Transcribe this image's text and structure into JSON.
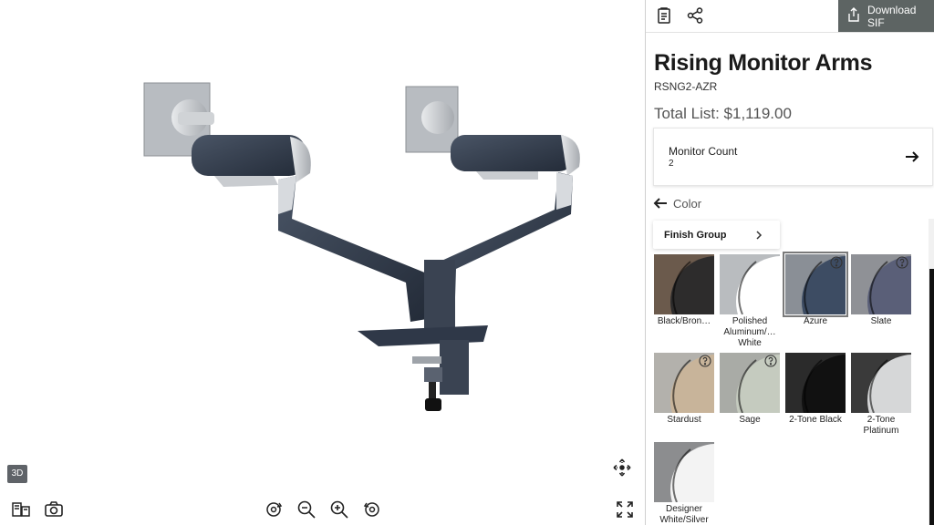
{
  "viewer": {
    "badge_3d": "3D",
    "icons": [
      "ar-view-icon",
      "camera-icon",
      "rotate-left-icon",
      "zoom-out-icon",
      "zoom-in-icon",
      "rotate-right-icon",
      "fullscreen-icon",
      "move-icon"
    ]
  },
  "panel": {
    "download_label": "Download SIF",
    "title": "Rising Monitor Arms",
    "sku": "RSNG2-AZR",
    "price": "Total List: $1,119.00",
    "monitor_card": {
      "label": "Monitor Count",
      "value": "2"
    },
    "back_label": "Color",
    "finish_group_label": "Finish Group",
    "selected_swatch": "Azure",
    "swatches": [
      {
        "name": "Black/Bron…",
        "color": "#2d2c2c",
        "tint": "#6b5a4c",
        "help": false
      },
      {
        "name": "Polished Aluminum/… White",
        "color": "#ffffff",
        "tint": "#b9bcbf",
        "help": false
      },
      {
        "name": "Azure",
        "color": "#3d4c63",
        "tint": "#8a8f96",
        "help": true
      },
      {
        "name": "Slate",
        "color": "#5a5f78",
        "tint": "#8f9196",
        "help": true
      },
      {
        "name": "Stardust",
        "color": "#c8b49a",
        "tint": "#b3b1ac",
        "help": true
      },
      {
        "name": "Sage",
        "color": "#c5cbbf",
        "tint": "#a9aba6",
        "help": true
      },
      {
        "name": "2-Tone Black",
        "color": "#111111",
        "tint": "#2b2b2b",
        "help": false
      },
      {
        "name": "2-Tone Platinum",
        "color": "#d6d7d8",
        "tint": "#3a3a3a",
        "help": false
      },
      {
        "name": "Designer White/Silver",
        "color": "#f3f3f3",
        "tint": "#8c8d8f",
        "help": false
      }
    ]
  },
  "colors": {
    "accent_dark": "#5d6463",
    "arm_navy": "#2f3848",
    "arm_silver": "#c9ccd0"
  }
}
